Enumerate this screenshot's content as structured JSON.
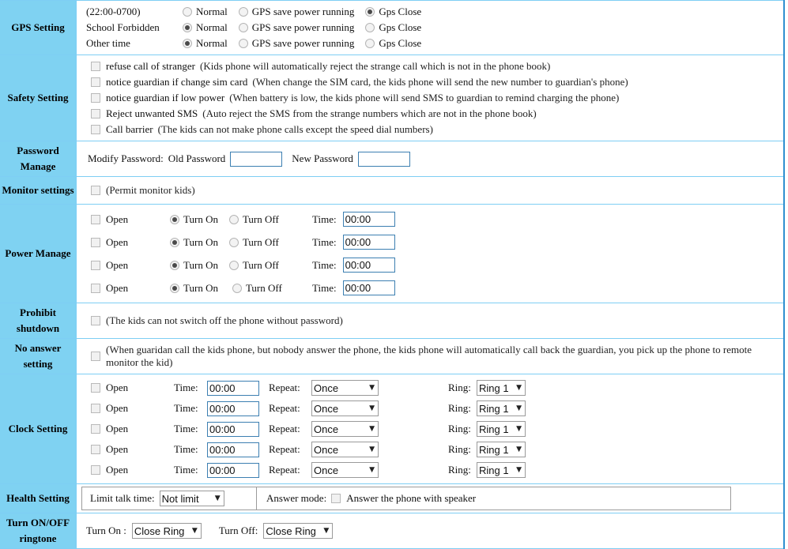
{
  "sections": {
    "gps": {
      "label": "GPS Setting",
      "option_labels": [
        "Normal",
        "GPS save power running",
        "Gps Close"
      ],
      "rows": [
        {
          "name": "(22:00-0700)",
          "selected": 2
        },
        {
          "name": "School Forbidden",
          "selected": 0
        },
        {
          "name": "Other time",
          "selected": 0
        }
      ]
    },
    "safety": {
      "label": "Safety Setting",
      "items": [
        {
          "name": "refuse call of stranger",
          "desc": "(Kids phone will automatically reject the strange call which is not in the phone book)",
          "checked": false
        },
        {
          "name": "notice guardian if change sim card",
          "desc": "(When change the SIM card, the kids phone will send the new number to guardian's phone)",
          "checked": false
        },
        {
          "name": "notice guardian if low power",
          "desc": "(When battery is low, the kids phone will send SMS to guardian to remind charging the phone)",
          "checked": false
        },
        {
          "name": "Reject unwanted SMS",
          "desc": "(Auto reject the SMS from the strange numbers which are not in the phone book)",
          "checked": false
        },
        {
          "name": "Call barrier",
          "desc": "(The kids can not make phone calls except the speed dial numbers)",
          "checked": false
        }
      ]
    },
    "password": {
      "label": "Password Manage",
      "title": "Modify Password:",
      "old_label": "Old Password",
      "old_value": "",
      "new_label": "New Password",
      "new_value": ""
    },
    "monitor": {
      "label": "Monitor settings",
      "desc": "(Permit monitor kids)",
      "checked": false
    },
    "power": {
      "label": "Power Manage",
      "open_label": "Open",
      "turn_on_label": "Turn On",
      "turn_off_label": "Turn Off",
      "time_label": "Time:",
      "rows": [
        {
          "open": false,
          "state": "on",
          "time": "00:00"
        },
        {
          "open": false,
          "state": "on",
          "time": "00:00"
        },
        {
          "open": false,
          "state": "on",
          "time": "00:00"
        },
        {
          "open": false,
          "state": "on",
          "time": "00:00"
        }
      ]
    },
    "prohibit": {
      "label": "Prohibit shutdown",
      "desc": "(The kids can not switch off the phone without password)",
      "checked": false
    },
    "no_answer": {
      "label": "No answer setting",
      "desc": "(When guaridan call the kids phone, but nobody answer the phone, the kids phone will automatically call back the guardian, you pick up the phone to remote monitor the kid)",
      "checked": false
    },
    "clock": {
      "label": "Clock Setting",
      "open_label": "Open",
      "time_label": "Time:",
      "repeat_label": "Repeat:",
      "ring_label": "Ring:",
      "repeat_options": [
        "Once"
      ],
      "ring_options": [
        "Ring 1"
      ],
      "rows": [
        {
          "open": false,
          "time": "00:00",
          "repeat": "Once",
          "ring": "Ring 1"
        },
        {
          "open": false,
          "time": "00:00",
          "repeat": "Once",
          "ring": "Ring 1"
        },
        {
          "open": false,
          "time": "00:00",
          "repeat": "Once",
          "ring": "Ring 1"
        },
        {
          "open": false,
          "time": "00:00",
          "repeat": "Once",
          "ring": "Ring 1"
        },
        {
          "open": false,
          "time": "00:00",
          "repeat": "Once",
          "ring": "Ring 1"
        }
      ]
    },
    "health": {
      "label": "Health Setting",
      "limit_label": "Limit talk time:",
      "limit_value": "Not limit",
      "answer_mode_label": "Answer mode:",
      "answer_speaker_label": "Answer the phone with speaker",
      "answer_checked": false
    },
    "ringtone": {
      "label": "Turn ON/OFF ringtone",
      "turn_on_label": "Turn On :",
      "turn_on_value": "Close Ring",
      "turn_off_label": "Turn Off:",
      "turn_off_value": "Close Ring"
    }
  },
  "colors": {
    "sidebar_bg": "#7fd2f2",
    "border": "#7ecef4",
    "outer_border": "#2f8fd0",
    "input_border": "#3c7fb1"
  }
}
